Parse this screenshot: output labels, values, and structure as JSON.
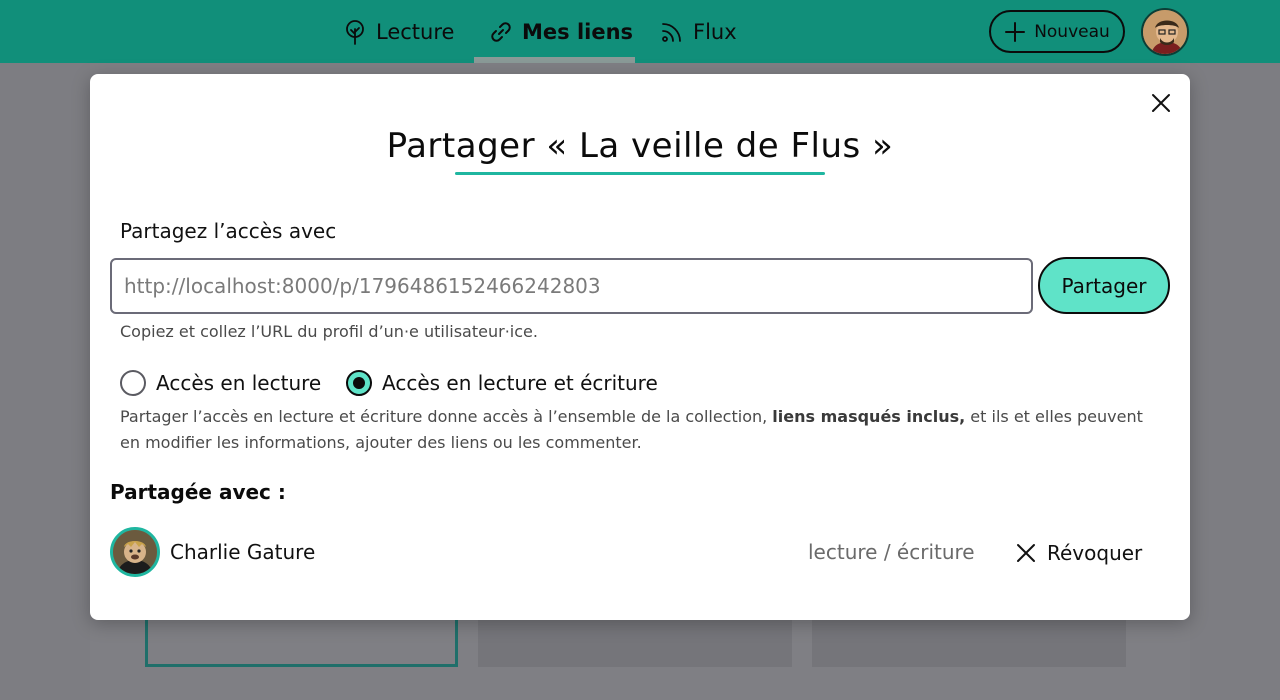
{
  "colors": {
    "header_bg": "#118f7a",
    "accent": "#1fb6a0",
    "primary_button": "#5fe3c8",
    "text": "#111111",
    "muted_text": "#4a4a4a"
  },
  "nav": {
    "items": [
      {
        "label": "Lecture",
        "icon": "tree-icon"
      },
      {
        "label": "Mes liens",
        "icon": "link-icon",
        "active": true
      },
      {
        "label": "Flux",
        "icon": "rss-icon"
      }
    ],
    "new_button": {
      "label": "Nouveau",
      "icon": "plus-icon"
    },
    "user_avatar": "avatar"
  },
  "modal": {
    "close_icon": "close-icon",
    "title": "Partager « La veille de Flus »",
    "share_label": "Partagez l’accès avec",
    "input": {
      "value": "",
      "placeholder": "http://localhost:8000/p/1796486152466242803"
    },
    "share_button": "Partager",
    "hint": "Copiez et collez l’URL du profil d’un·e utilisateur·ice.",
    "access_options": [
      {
        "label": "Accès en lecture",
        "checked": false
      },
      {
        "label": "Accès en lecture et écriture",
        "checked": true
      }
    ],
    "description": {
      "before": "Partager l’accès en lecture et écriture donne accès à l’ensemble de la collection, ",
      "bold": "liens masqués inclus,",
      "after": " et ils et elles peuvent en modifier les informations, ajouter des liens ou les commenter."
    },
    "shared_with_title": "Partagée avec :",
    "shares": [
      {
        "name": "Charlie Gature",
        "access": "lecture / écriture",
        "revoke_label": "Révoquer"
      }
    ]
  }
}
